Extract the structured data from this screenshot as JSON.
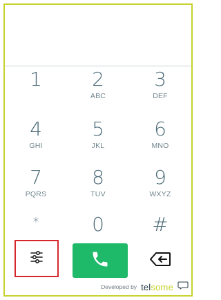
{
  "keypad": {
    "keys": [
      {
        "digit": "1",
        "letters": ""
      },
      {
        "digit": "2",
        "letters": "ABC"
      },
      {
        "digit": "3",
        "letters": "DEF"
      },
      {
        "digit": "4",
        "letters": "GHI"
      },
      {
        "digit": "5",
        "letters": "JKL"
      },
      {
        "digit": "6",
        "letters": "MNO"
      },
      {
        "digit": "7",
        "letters": "PQRS"
      },
      {
        "digit": "8",
        "letters": "TUV"
      },
      {
        "digit": "9",
        "letters": "WXYZ"
      },
      {
        "digit": "*",
        "letters": ""
      },
      {
        "digit": "0",
        "letters": ""
      },
      {
        "digit": "#",
        "letters": ""
      }
    ]
  },
  "controls": {
    "settings_icon": "sliders-icon",
    "call_icon": "phone-icon",
    "backspace_icon": "backspace-icon"
  },
  "footer": {
    "developed_by": "Developed by",
    "brand_part1": "tel",
    "brand_part2": "some"
  },
  "colors": {
    "frame": "#c7d22e",
    "call": "#1fb96a",
    "highlight": "#d7262b",
    "digit": "#4f6d79"
  }
}
